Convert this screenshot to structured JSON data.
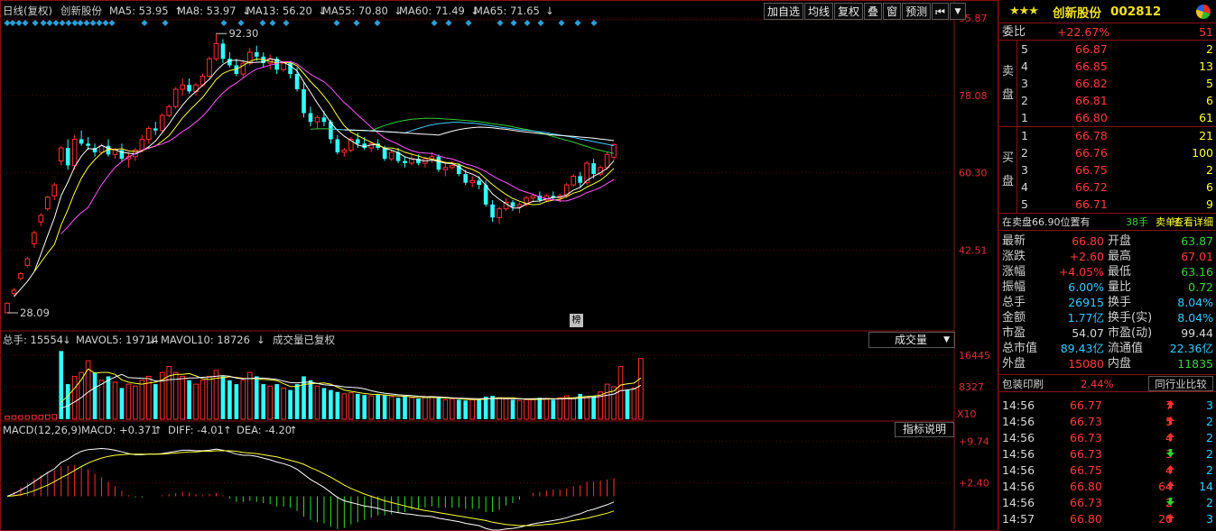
{
  "header": {
    "period": "日线(复权)",
    "stock": "创新股份",
    "ma": [
      {
        "label": "MA5: 53.95",
        "arrow": "↑",
        "color": "#ffffff"
      },
      {
        "label": "MA8: 53.97",
        "arrow": "↓",
        "color": "#ffff33"
      },
      {
        "label": "MA13: 56.20",
        "arrow": "↓",
        "color": "#ff55ff"
      },
      {
        "label": "MA55: 70.80",
        "arrow": "↓",
        "color": "#33cc33"
      },
      {
        "label": "MA60: 71.49",
        "arrow": "↓",
        "color": "#44ccff"
      },
      {
        "label": "MA65: 71.65",
        "arrow": "↓",
        "color": "#ffffff"
      }
    ]
  },
  "toolbar": {
    "items": [
      "加自选",
      "均线",
      "复权",
      "叠",
      "窗",
      "预测"
    ],
    "jump": "⏮",
    "dropdown": "▼"
  },
  "badge": "榜",
  "price_labels": {
    "high": "92.30",
    "low": "28.09"
  },
  "volume": {
    "total": "总手: 15554",
    "mavol5": "MAVOL5: 19714",
    "mavol10": "MAVOL10: 18726",
    "note": "成交量已复权",
    "selector": "成交量",
    "arrow_down": "↓",
    "arrow_up": "↑",
    "multiplier": "X10"
  },
  "macd": {
    "name": "MACD(12,26,9)",
    "macd": "MACD: +0.371",
    "diff": "DIFF: -4.01",
    "dea": "DEA: -4.20",
    "button": "指标说明"
  },
  "chart_data": [
    {
      "type": "candlestick",
      "name": "price",
      "y_axis": [
        "95.87",
        "78.08",
        "60.30",
        "42.51"
      ],
      "ylim": [
        28.09,
        95.87
      ],
      "candles": [
        [
          28.1,
          30.5,
          28.09,
          30.3
        ],
        [
          32.5,
          33.8,
          32.0,
          33.3
        ],
        [
          36.0,
          37.5,
          35.5,
          37.1
        ],
        [
          39.0,
          41.0,
          38.5,
          40.5
        ],
        [
          44.0,
          47.0,
          43.0,
          46.5
        ],
        [
          49.0,
          51.0,
          48.0,
          50.5
        ],
        [
          52.0,
          55.0,
          51.5,
          54.7
        ],
        [
          55.0,
          58.0,
          54.0,
          57.5
        ],
        [
          63.0,
          66.5,
          62.0,
          66.0
        ],
        [
          66.0,
          68.0,
          61.0,
          62.0
        ],
        [
          62.0,
          69.0,
          61.0,
          68.0
        ],
        [
          68.0,
          70.0,
          66.5,
          67.0
        ],
        [
          67.0,
          68.5,
          65.5,
          66.5
        ],
        [
          66.0,
          67.0,
          64.0,
          65.0
        ],
        [
          65.0,
          67.0,
          64.5,
          66.5
        ],
        [
          66.5,
          68.0,
          64.0,
          64.5
        ],
        [
          64.5,
          66.0,
          63.5,
          65.5
        ],
        [
          65.5,
          67.0,
          63.0,
          63.5
        ],
        [
          63.5,
          65.0,
          61.5,
          64.0
        ],
        [
          64.0,
          66.0,
          63.0,
          65.5
        ],
        [
          65.5,
          69.0,
          65.0,
          68.0
        ],
        [
          68.0,
          71.0,
          67.0,
          70.5
        ],
        [
          70.5,
          72.0,
          69.0,
          70.0
        ],
        [
          70.0,
          74.0,
          69.5,
          73.5
        ],
        [
          73.5,
          76.0,
          73.0,
          75.5
        ],
        [
          75.5,
          80.0,
          75.0,
          79.5
        ],
        [
          79.5,
          82.0,
          78.0,
          80.5
        ],
        [
          80.5,
          82.0,
          78.5,
          79.0
        ],
        [
          79.0,
          81.0,
          78.0,
          80.5
        ],
        [
          80.5,
          83.0,
          80.0,
          82.5
        ],
        [
          82.5,
          87.0,
          82.0,
          86.5
        ],
        [
          86.5,
          92.3,
          86.0,
          90.0
        ],
        [
          90.0,
          91.0,
          85.5,
          86.5
        ],
        [
          86.5,
          88.0,
          84.5,
          85.0
        ],
        [
          85.0,
          86.5,
          82.5,
          83.0
        ],
        [
          83.0,
          86.0,
          82.0,
          85.5
        ],
        [
          85.5,
          89.0,
          85.0,
          88.0
        ],
        [
          88.0,
          89.5,
          86.0,
          87.0
        ],
        [
          87.0,
          88.0,
          84.5,
          85.5
        ],
        [
          85.5,
          87.5,
          84.0,
          86.5
        ],
        [
          86.5,
          87.0,
          83.0,
          84.0
        ],
        [
          84.0,
          86.0,
          83.5,
          85.5
        ],
        [
          85.5,
          86.0,
          82.0,
          83.0
        ],
        [
          83.0,
          84.5,
          79.0,
          79.5
        ],
        [
          79.5,
          81.0,
          73.0,
          74.0
        ],
        [
          74.0,
          75.5,
          71.0,
          72.0
        ],
        [
          72.0,
          73.5,
          70.5,
          73.0
        ],
        [
          73.0,
          74.5,
          71.0,
          72.0
        ],
        [
          72.0,
          72.5,
          67.0,
          68.0
        ],
        [
          68.0,
          69.0,
          64.5,
          65.0
        ],
        [
          65.0,
          66.0,
          64.0,
          65.5
        ],
        [
          65.5,
          68.5,
          65.0,
          68.0
        ],
        [
          68.0,
          69.5,
          66.0,
          67.0
        ],
        [
          67.0,
          68.5,
          65.5,
          66.0
        ],
        [
          66.0,
          67.5,
          65.0,
          67.0
        ],
        [
          67.0,
          68.0,
          65.5,
          66.0
        ],
        [
          66.0,
          66.5,
          63.0,
          63.5
        ],
        [
          63.5,
          65.5,
          63.0,
          65.0
        ],
        [
          65.0,
          66.0,
          62.5,
          63.0
        ],
        [
          63.0,
          64.0,
          61.5,
          62.5
        ],
        [
          62.5,
          64.5,
          62.0,
          63.5
        ],
        [
          63.5,
          64.5,
          62.0,
          62.5
        ],
        [
          62.5,
          64.0,
          61.5,
          63.5
        ],
        [
          63.5,
          65.0,
          62.5,
          64.0
        ],
        [
          64.0,
          64.5,
          60.5,
          61.0
        ],
        [
          61.0,
          62.5,
          59.5,
          61.5
        ],
        [
          61.5,
          63.0,
          61.0,
          62.0
        ],
        [
          62.0,
          62.5,
          59.5,
          60.0
        ],
        [
          60.0,
          61.0,
          57.5,
          58.0
        ],
        [
          58.0,
          59.5,
          57.0,
          58.5
        ],
        [
          58.5,
          59.5,
          56.5,
          57.5
        ],
        [
          57.5,
          58.5,
          52.5,
          53.0
        ],
        [
          53.0,
          54.0,
          49.0,
          50.0
        ],
        [
          50.0,
          52.5,
          48.5,
          52.0
        ],
        [
          52.0,
          54.5,
          51.5,
          53.5
        ],
        [
          53.5,
          54.0,
          51.5,
          52.5
        ],
        [
          52.5,
          53.5,
          51.0,
          53.0
        ],
        [
          53.0,
          55.0,
          52.5,
          54.5
        ],
        [
          54.5,
          55.5,
          53.5,
          55.0
        ],
        [
          55.0,
          56.0,
          53.5,
          54.0
        ],
        [
          54.0,
          55.5,
          53.5,
          55.0
        ],
        [
          55.0,
          56.0,
          54.0,
          54.5
        ],
        [
          54.5,
          55.5,
          53.5,
          55.0
        ],
        [
          55.0,
          58.0,
          54.5,
          57.5
        ],
        [
          57.5,
          60.0,
          57.0,
          59.5
        ],
        [
          59.5,
          60.5,
          57.0,
          58.0
        ],
        [
          58.0,
          63.0,
          57.5,
          62.5
        ],
        [
          62.5,
          63.5,
          59.0,
          60.0
        ],
        [
          60.0,
          62.0,
          59.5,
          61.5
        ],
        [
          61.5,
          65.0,
          61.0,
          64.5
        ],
        [
          63.87,
          67.01,
          63.16,
          66.8
        ]
      ]
    },
    {
      "type": "bar",
      "name": "volume",
      "y_axis": [
        "16445",
        "8327"
      ],
      "ylim": [
        0,
        18500
      ],
      "values": [
        800,
        900,
        900,
        900,
        1000,
        1000,
        1100,
        1200,
        17500,
        9000,
        11000,
        12000,
        15000,
        12000,
        10000,
        11000,
        9500,
        8000,
        9000,
        8500,
        10000,
        11000,
        9000,
        12000,
        13500,
        12000,
        11000,
        10000,
        9000,
        10000,
        11000,
        12500,
        11000,
        10000,
        9000,
        10000,
        12000,
        11000,
        9000,
        8500,
        9000,
        8000,
        7500,
        9000,
        11000,
        10000,
        8500,
        8000,
        7500,
        7000,
        6500,
        6800,
        6500,
        6200,
        6000,
        6300,
        6100,
        5800,
        5500,
        5800,
        5500,
        5300,
        5600,
        5800,
        5500,
        5000,
        5200,
        5000,
        4800,
        5200,
        5000,
        5800,
        6000,
        5500,
        5200,
        5000,
        4800,
        5000,
        5200,
        5500,
        5300,
        5000,
        5500,
        6000,
        5500,
        6500,
        5800,
        6000,
        7000,
        9000,
        8327,
        13500,
        7500,
        8000,
        15554
      ],
      "up": [
        1,
        1,
        1,
        1,
        1,
        1,
        1,
        1,
        0,
        0,
        1,
        1,
        1,
        0,
        1,
        0,
        1,
        0,
        1,
        1,
        1,
        1,
        0,
        1,
        1,
        1,
        1,
        0,
        1,
        1,
        1,
        1,
        0,
        0,
        0,
        1,
        1,
        0,
        0,
        1,
        0,
        1,
        0,
        0,
        0,
        0,
        1,
        0,
        0,
        0,
        1,
        1,
        0,
        0,
        1,
        0,
        0,
        1,
        0,
        0,
        1,
        0,
        1,
        1,
        0,
        1,
        1,
        0,
        0,
        1,
        0,
        0,
        0,
        1,
        1,
        0,
        1,
        1,
        1,
        0,
        1,
        0,
        1,
        1,
        1,
        0,
        1,
        0,
        1,
        1,
        1,
        1,
        0,
        1,
        1
      ]
    },
    {
      "type": "macd",
      "name": "macd",
      "y_axis": [
        "+9.74",
        "+2.40"
      ],
      "ylim": [
        -6.0,
        10.5
      ],
      "diff": [
        0.0,
        0.5,
        1.1,
        1.8,
        2.6,
        3.4,
        4.2,
        4.9,
        6.0,
        6.6,
        7.4,
        8.0,
        8.3,
        8.4,
        8.5,
        8.4,
        8.2,
        7.9,
        7.6,
        7.4,
        7.4,
        7.5,
        7.5,
        7.6,
        7.8,
        8.0,
        8.2,
        8.2,
        8.1,
        8.1,
        8.2,
        8.4,
        8.2,
        7.9,
        7.5,
        7.3,
        7.3,
        7.1,
        6.8,
        6.5,
        6.1,
        5.8,
        5.4,
        4.8,
        3.9,
        3.0,
        2.3,
        1.6,
        0.7,
        -0.2,
        -0.8,
        -1.1,
        -1.4,
        -1.7,
        -1.9,
        -2.1,
        -2.5,
        -2.7,
        -2.9,
        -3.1,
        -3.2,
        -3.4,
        -3.5,
        -3.6,
        -3.9,
        -4.1,
        -4.3,
        -4.5,
        -4.8,
        -5.0,
        -5.2,
        -5.7,
        -6.0,
        -6.0,
        -5.8,
        -5.7,
        -5.5,
        -5.2,
        -4.9,
        -4.7,
        -4.5,
        -4.3,
        -4.1,
        -3.8,
        -3.4,
        -3.1,
        -2.6,
        -2.3,
        -1.9,
        -1.5,
        -1.0
      ],
      "dea": [
        0.0,
        0.1,
        0.3,
        0.6,
        1.0,
        1.5,
        2.0,
        2.6,
        3.3,
        3.9,
        4.6,
        5.3,
        5.9,
        6.4,
        6.8,
        7.1,
        7.3,
        7.4,
        7.5,
        7.5,
        7.5,
        7.5,
        7.5,
        7.5,
        7.6,
        7.7,
        7.8,
        7.9,
        7.9,
        8.0,
        8.0,
        8.1,
        8.1,
        8.1,
        8.0,
        7.8,
        7.7,
        7.6,
        7.4,
        7.2,
        7.0,
        6.7,
        6.4,
        6.1,
        5.7,
        5.1,
        4.6,
        4.0,
        3.4,
        2.7,
        2.0,
        1.4,
        0.9,
        0.4,
        0.0,
        -0.4,
        -0.8,
        -1.1,
        -1.4,
        -1.7,
        -2.0,
        -2.3,
        -2.5,
        -2.7,
        -2.9,
        -3.1,
        -3.3,
        -3.5,
        -3.7,
        -3.9,
        -4.1,
        -4.3,
        -4.6,
        -4.8,
        -5.0,
        -5.1,
        -5.2,
        -5.2,
        -5.2,
        -5.1,
        -5.0,
        -4.9,
        -4.7,
        -4.5,
        -4.3,
        -4.1,
        -3.9,
        -3.6,
        -3.3,
        -3.0,
        -2.6
      ]
    }
  ],
  "panel": {
    "stars": "★★★",
    "name": "创新股份",
    "code": "002812",
    "weibi": {
      "label": "委比",
      "value": "+22.67%",
      "diff": "51"
    },
    "sell_label": [
      "卖",
      "盘"
    ],
    "buy_label": [
      "买",
      "盘"
    ],
    "sell": [
      {
        "i": "5",
        "p": "66.87",
        "q": "2"
      },
      {
        "i": "4",
        "p": "66.85",
        "q": "13"
      },
      {
        "i": "3",
        "p": "66.82",
        "q": "5"
      },
      {
        "i": "2",
        "p": "66.81",
        "q": "6"
      },
      {
        "i": "1",
        "p": "66.80",
        "q": "61"
      }
    ],
    "buy": [
      {
        "i": "1",
        "p": "66.78",
        "q": "21"
      },
      {
        "i": "2",
        "p": "66.76",
        "q": "100"
      },
      {
        "i": "3",
        "p": "66.75",
        "q": "2"
      },
      {
        "i": "4",
        "p": "66.72",
        "q": "6"
      },
      {
        "i": "5",
        "p": "66.71",
        "q": "9"
      }
    ],
    "hint": {
      "a": "在卖盘66.90位置有",
      "b": "38手",
      "c": "卖单!",
      "d": "查看详细"
    },
    "quote": [
      {
        "k1": "最新",
        "v1": "66.80",
        "k2": "开盘",
        "v2": "63.87",
        "c2": "vg"
      },
      {
        "k1": "涨跌",
        "v1": "+2.60",
        "k2": "最高",
        "v2": "67.01",
        "c2": ""
      },
      {
        "k1": "涨幅",
        "v1": "+4.05%",
        "k2": "最低",
        "v2": "63.16",
        "c2": "vg"
      },
      {
        "k1": "振幅",
        "v1": "6.00%",
        "c1": "vc",
        "k2": "量比",
        "v2": "0.72",
        "c2": "vg"
      },
      {
        "k1": "总手",
        "v1": "26915",
        "c1": "vc",
        "k2": "换手",
        "v2": "8.04%",
        "c2": "vc"
      },
      {
        "k1": "金额",
        "v1": "1.77亿",
        "c1": "vc",
        "k2": "换手(实)",
        "v2": "8.04%",
        "c2": "vc"
      },
      {
        "k1": "市盈",
        "v1": "54.07",
        "c1": "vw",
        "k2": "市盈(动)",
        "v2": "99.44",
        "c2": "vw"
      },
      {
        "k1": "总市值",
        "v1": "89.43亿",
        "c1": "vc",
        "k2": "流通值",
        "v2": "22.36亿",
        "c2": "vc"
      },
      {
        "k1": "外盘",
        "v1": "15080",
        "k2": "内盘",
        "v2": "11835",
        "c2": "vg"
      }
    ],
    "industry": {
      "name": "包装印刷",
      "pct": "2.44%",
      "button": "同行业比较"
    },
    "ticks": [
      {
        "t": "14:56",
        "p": "66.77",
        "v": "7",
        "dir": "up",
        "n": "3"
      },
      {
        "t": "14:56",
        "p": "66.73",
        "v": "5",
        "dir": "up",
        "n": "2"
      },
      {
        "t": "14:56",
        "p": "66.73",
        "v": "4",
        "dir": "up",
        "n": "2"
      },
      {
        "t": "14:56",
        "p": "66.73",
        "v": "3",
        "dir": "dn",
        "n": "2"
      },
      {
        "t": "14:56",
        "p": "66.75",
        "v": "4",
        "dir": "up",
        "n": "2"
      },
      {
        "t": "14:56",
        "p": "66.80",
        "v": "64",
        "dir": "up",
        "n": "14"
      },
      {
        "t": "14:56",
        "p": "66.73",
        "v": "2",
        "dir": "dn",
        "n": "2"
      },
      {
        "t": "14:57",
        "p": "66.80",
        "v": "20",
        "dir": "up",
        "n": "3"
      }
    ]
  }
}
